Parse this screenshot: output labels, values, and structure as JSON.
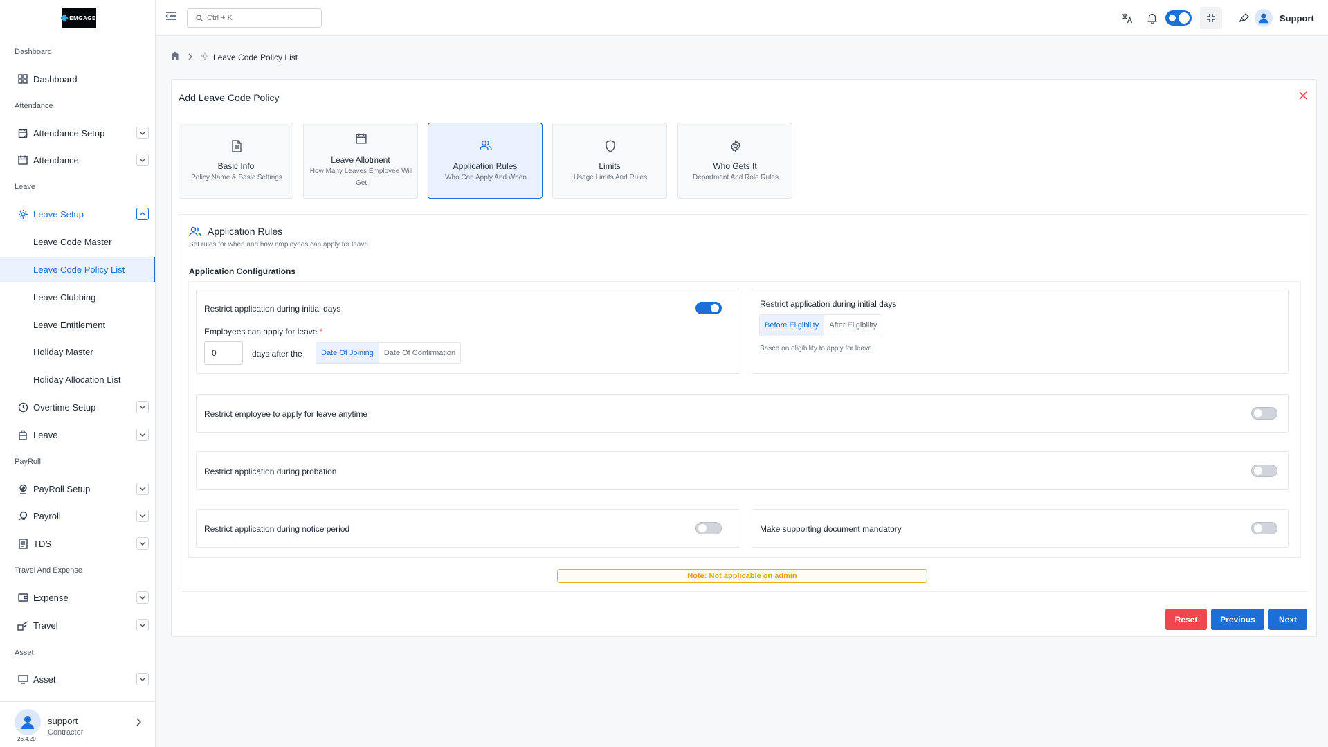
{
  "sidebar": {
    "logo_text": "EMGAGE",
    "sections": {
      "dashboard": "Dashboard",
      "attendance": "Attendance",
      "leave": "Leave",
      "payroll": "PayRoll",
      "travel": "Travel And Expense",
      "asset": "Asset"
    },
    "items": {
      "dashboard": "Dashboard",
      "attendance_setup": "Attendance Setup",
      "attendance": "Attendance",
      "leave_setup": "Leave Setup",
      "leave_code_master": "Leave Code Master",
      "leave_code_policy_list": "Leave Code Policy List",
      "leave_clubbing": "Leave Clubbing",
      "leave_entitlement": "Leave Entitlement",
      "holiday_master": "Holiday Master",
      "holiday_allocation_list": "Holiday Allocation List",
      "overtime_setup": "Overtime Setup",
      "leave": "Leave",
      "payroll_setup": "PayRoll Setup",
      "payroll": "Payroll",
      "tds": "TDS",
      "expense": "Expense",
      "travel": "Travel",
      "asset": "Asset"
    },
    "profile": {
      "name": "support",
      "role": "Contractor",
      "version": "26.4.20"
    }
  },
  "topbar": {
    "search_placeholder": "Ctrl + K",
    "user_name": "Support"
  },
  "breadcrumb": {
    "current": "Leave Code Policy List"
  },
  "card": {
    "title": "Add Leave Code Policy",
    "steps": [
      {
        "title": "Basic Info",
        "subtitle": "Policy Name & Basic Settings"
      },
      {
        "title": "Leave Allotment",
        "subtitle": "How Many Leaves Employee Will Get"
      },
      {
        "title": "Application Rules",
        "subtitle": "Who Can Apply And When"
      },
      {
        "title": "Limits",
        "subtitle": "Usage Limits And Rules"
      },
      {
        "title": "Who Gets It",
        "subtitle": "Department And Role Rules"
      }
    ],
    "section_title": "Application Rules",
    "section_subtitle": "Set rules for when and how employees can apply for leave",
    "config_title": "Application Configurations",
    "rules": {
      "initial_days_label": "Restrict application during initial days",
      "initial_days_enabled": true,
      "employees_can_apply_label": "Employees can apply for leave",
      "required_mark": "*",
      "days_value": "0",
      "days_after_label": "days after the",
      "basis_options": [
        "Date Of Joining",
        "Date Of Confirmation"
      ],
      "basis_selected": "Date Of Joining",
      "eligibility_label": "Restrict application during initial days",
      "eligibility_options": [
        "Before Eligibility",
        "After Eligibility"
      ],
      "eligibility_selected": "Before Eligibility",
      "eligibility_hint": "Based on eligibility to apply for leave",
      "anytime_label": "Restrict employee to apply for leave anytime",
      "anytime_enabled": false,
      "probation_label": "Restrict application during probation",
      "probation_enabled": false,
      "notice_label": "Restrict application during notice period",
      "notice_enabled": false,
      "document_label": "Make supporting document mandatory",
      "document_enabled": false
    },
    "note": "Note: Not applicable on admin",
    "buttons": {
      "reset": "Reset",
      "previous": "Previous",
      "next": "Next"
    }
  },
  "colors": {
    "primary": "#1d6fd8",
    "danger": "#f0464d",
    "note": "#e3a008"
  }
}
